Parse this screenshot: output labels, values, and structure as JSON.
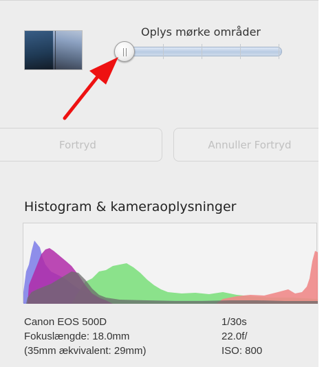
{
  "adjustment": {
    "label": "Oplys mørke områder",
    "level": 0
  },
  "buttons": {
    "undo_label": "Fortryd",
    "redo_label": "Annuller Fortryd"
  },
  "histogram": {
    "title": "Histogram & kameraoplysninger"
  },
  "camera": {
    "model": "Canon EOS 500D",
    "focal_length": "Fokuslængde: 18.0mm",
    "equivalent": "(35mm ækvivalent:  29mm)",
    "shutter": "1/30s",
    "aperture": "22.0f/",
    "iso": "ISO: 800"
  },
  "colors": {
    "panel_bg": "#ededed",
    "arrow": "#ee1111",
    "histogram_blue": "#7b7be8",
    "histogram_magenta": "#b02aa8",
    "histogram_green": "#7fe07f",
    "histogram_red": "#f08a8a",
    "histogram_gray": "#6b6b6b"
  },
  "icons": {
    "thumbnail": "before-after-thumbnail-icon",
    "arrow": "red-arrow-annotation-icon"
  }
}
